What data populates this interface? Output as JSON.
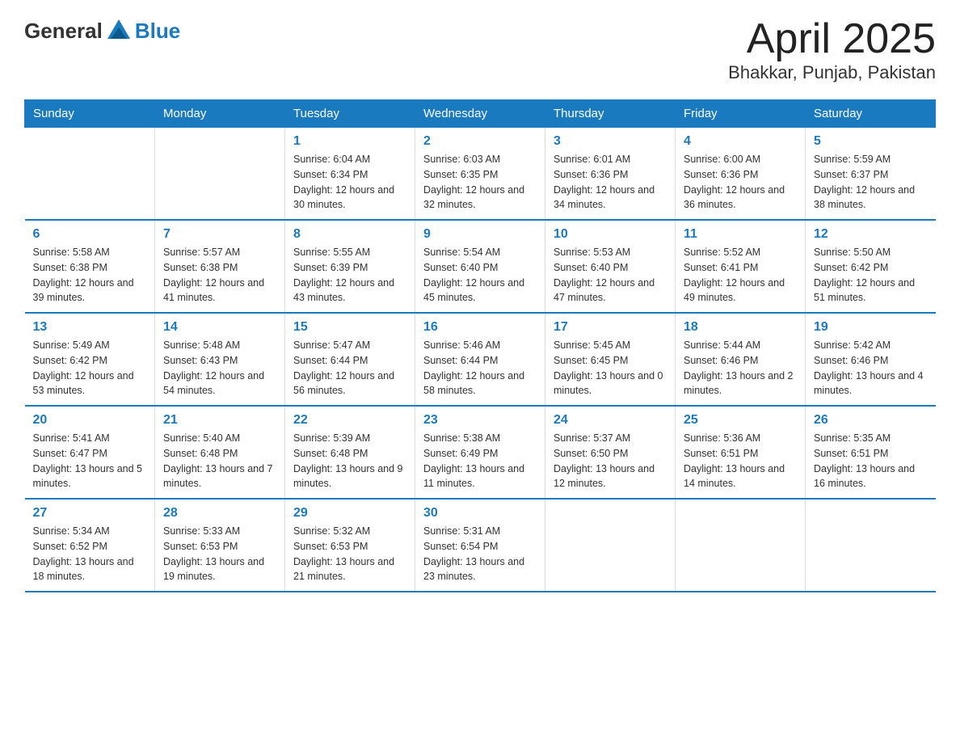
{
  "header": {
    "logo_general": "General",
    "logo_blue": "Blue",
    "title": "April 2025",
    "subtitle": "Bhakkar, Punjab, Pakistan"
  },
  "calendar": {
    "days_of_week": [
      "Sunday",
      "Monday",
      "Tuesday",
      "Wednesday",
      "Thursday",
      "Friday",
      "Saturday"
    ],
    "weeks": [
      [
        {
          "day": "",
          "sunrise": "",
          "sunset": "",
          "daylight": ""
        },
        {
          "day": "",
          "sunrise": "",
          "sunset": "",
          "daylight": ""
        },
        {
          "day": "1",
          "sunrise": "Sunrise: 6:04 AM",
          "sunset": "Sunset: 6:34 PM",
          "daylight": "Daylight: 12 hours and 30 minutes."
        },
        {
          "day": "2",
          "sunrise": "Sunrise: 6:03 AM",
          "sunset": "Sunset: 6:35 PM",
          "daylight": "Daylight: 12 hours and 32 minutes."
        },
        {
          "day": "3",
          "sunrise": "Sunrise: 6:01 AM",
          "sunset": "Sunset: 6:36 PM",
          "daylight": "Daylight: 12 hours and 34 minutes."
        },
        {
          "day": "4",
          "sunrise": "Sunrise: 6:00 AM",
          "sunset": "Sunset: 6:36 PM",
          "daylight": "Daylight: 12 hours and 36 minutes."
        },
        {
          "day": "5",
          "sunrise": "Sunrise: 5:59 AM",
          "sunset": "Sunset: 6:37 PM",
          "daylight": "Daylight: 12 hours and 38 minutes."
        }
      ],
      [
        {
          "day": "6",
          "sunrise": "Sunrise: 5:58 AM",
          "sunset": "Sunset: 6:38 PM",
          "daylight": "Daylight: 12 hours and 39 minutes."
        },
        {
          "day": "7",
          "sunrise": "Sunrise: 5:57 AM",
          "sunset": "Sunset: 6:38 PM",
          "daylight": "Daylight: 12 hours and 41 minutes."
        },
        {
          "day": "8",
          "sunrise": "Sunrise: 5:55 AM",
          "sunset": "Sunset: 6:39 PM",
          "daylight": "Daylight: 12 hours and 43 minutes."
        },
        {
          "day": "9",
          "sunrise": "Sunrise: 5:54 AM",
          "sunset": "Sunset: 6:40 PM",
          "daylight": "Daylight: 12 hours and 45 minutes."
        },
        {
          "day": "10",
          "sunrise": "Sunrise: 5:53 AM",
          "sunset": "Sunset: 6:40 PM",
          "daylight": "Daylight: 12 hours and 47 minutes."
        },
        {
          "day": "11",
          "sunrise": "Sunrise: 5:52 AM",
          "sunset": "Sunset: 6:41 PM",
          "daylight": "Daylight: 12 hours and 49 minutes."
        },
        {
          "day": "12",
          "sunrise": "Sunrise: 5:50 AM",
          "sunset": "Sunset: 6:42 PM",
          "daylight": "Daylight: 12 hours and 51 minutes."
        }
      ],
      [
        {
          "day": "13",
          "sunrise": "Sunrise: 5:49 AM",
          "sunset": "Sunset: 6:42 PM",
          "daylight": "Daylight: 12 hours and 53 minutes."
        },
        {
          "day": "14",
          "sunrise": "Sunrise: 5:48 AM",
          "sunset": "Sunset: 6:43 PM",
          "daylight": "Daylight: 12 hours and 54 minutes."
        },
        {
          "day": "15",
          "sunrise": "Sunrise: 5:47 AM",
          "sunset": "Sunset: 6:44 PM",
          "daylight": "Daylight: 12 hours and 56 minutes."
        },
        {
          "day": "16",
          "sunrise": "Sunrise: 5:46 AM",
          "sunset": "Sunset: 6:44 PM",
          "daylight": "Daylight: 12 hours and 58 minutes."
        },
        {
          "day": "17",
          "sunrise": "Sunrise: 5:45 AM",
          "sunset": "Sunset: 6:45 PM",
          "daylight": "Daylight: 13 hours and 0 minutes."
        },
        {
          "day": "18",
          "sunrise": "Sunrise: 5:44 AM",
          "sunset": "Sunset: 6:46 PM",
          "daylight": "Daylight: 13 hours and 2 minutes."
        },
        {
          "day": "19",
          "sunrise": "Sunrise: 5:42 AM",
          "sunset": "Sunset: 6:46 PM",
          "daylight": "Daylight: 13 hours and 4 minutes."
        }
      ],
      [
        {
          "day": "20",
          "sunrise": "Sunrise: 5:41 AM",
          "sunset": "Sunset: 6:47 PM",
          "daylight": "Daylight: 13 hours and 5 minutes."
        },
        {
          "day": "21",
          "sunrise": "Sunrise: 5:40 AM",
          "sunset": "Sunset: 6:48 PM",
          "daylight": "Daylight: 13 hours and 7 minutes."
        },
        {
          "day": "22",
          "sunrise": "Sunrise: 5:39 AM",
          "sunset": "Sunset: 6:48 PM",
          "daylight": "Daylight: 13 hours and 9 minutes."
        },
        {
          "day": "23",
          "sunrise": "Sunrise: 5:38 AM",
          "sunset": "Sunset: 6:49 PM",
          "daylight": "Daylight: 13 hours and 11 minutes."
        },
        {
          "day": "24",
          "sunrise": "Sunrise: 5:37 AM",
          "sunset": "Sunset: 6:50 PM",
          "daylight": "Daylight: 13 hours and 12 minutes."
        },
        {
          "day": "25",
          "sunrise": "Sunrise: 5:36 AM",
          "sunset": "Sunset: 6:51 PM",
          "daylight": "Daylight: 13 hours and 14 minutes."
        },
        {
          "day": "26",
          "sunrise": "Sunrise: 5:35 AM",
          "sunset": "Sunset: 6:51 PM",
          "daylight": "Daylight: 13 hours and 16 minutes."
        }
      ],
      [
        {
          "day": "27",
          "sunrise": "Sunrise: 5:34 AM",
          "sunset": "Sunset: 6:52 PM",
          "daylight": "Daylight: 13 hours and 18 minutes."
        },
        {
          "day": "28",
          "sunrise": "Sunrise: 5:33 AM",
          "sunset": "Sunset: 6:53 PM",
          "daylight": "Daylight: 13 hours and 19 minutes."
        },
        {
          "day": "29",
          "sunrise": "Sunrise: 5:32 AM",
          "sunset": "Sunset: 6:53 PM",
          "daylight": "Daylight: 13 hours and 21 minutes."
        },
        {
          "day": "30",
          "sunrise": "Sunrise: 5:31 AM",
          "sunset": "Sunset: 6:54 PM",
          "daylight": "Daylight: 13 hours and 23 minutes."
        },
        {
          "day": "",
          "sunrise": "",
          "sunset": "",
          "daylight": ""
        },
        {
          "day": "",
          "sunrise": "",
          "sunset": "",
          "daylight": ""
        },
        {
          "day": "",
          "sunrise": "",
          "sunset": "",
          "daylight": ""
        }
      ]
    ]
  }
}
